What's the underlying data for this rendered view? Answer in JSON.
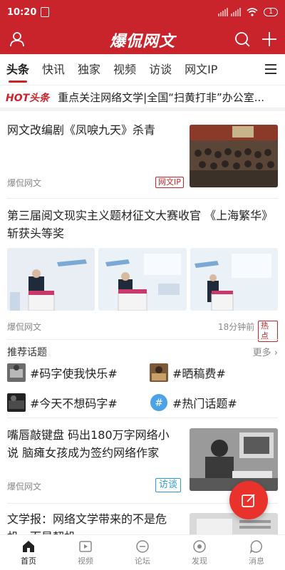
{
  "status": {
    "time": "10:20",
    "battery": "1"
  },
  "app": {
    "logo": "爆侃网文"
  },
  "tabs": [
    {
      "label": "头条"
    },
    {
      "label": "快讯"
    },
    {
      "label": "独家"
    },
    {
      "label": "视频"
    },
    {
      "label": "访谈"
    },
    {
      "label": "网文IP"
    }
  ],
  "hot": {
    "tag": "HOT头条",
    "text": "重点关注网络文学|全国“扫黄打非”办公室..."
  },
  "news": [
    {
      "title": "网文改编剧《凤唳九天》杀青",
      "source": "爆侃网文",
      "badge": "网文IP"
    },
    {
      "title": "第三届阅文现实主义题材征文大赛收官 《上海繁华》斩获头等奖",
      "source": "爆侃网文",
      "time": "18分钟前",
      "badge": "热点"
    },
    {
      "title": "嘴唇敲键盘 码出180万字网络小说 脑瘫女孩成为签约网络作家",
      "source": "爆侃网文",
      "badge": "访谈"
    },
    {
      "title": "文学报：网络文学带来的不是危机，而是契机"
    }
  ],
  "topics": {
    "header": "推荐话题",
    "more": "更多",
    "items": [
      {
        "label": "#码字使我快乐#"
      },
      {
        "label": "#晒稿费#"
      },
      {
        "label": "#今天不想码字#"
      },
      {
        "label": "#热门话题#"
      }
    ]
  },
  "nav": [
    {
      "label": "首页"
    },
    {
      "label": "视频"
    },
    {
      "label": "论坛"
    },
    {
      "label": "发现"
    },
    {
      "label": "消息"
    }
  ]
}
